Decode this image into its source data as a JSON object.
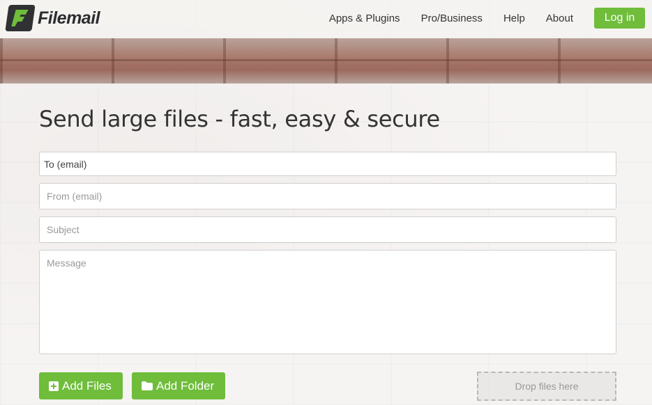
{
  "brand": {
    "name": "Filemail",
    "accent": "#6fbd3b"
  },
  "nav": {
    "items": [
      {
        "label": "Apps & Plugins"
      },
      {
        "label": "Pro/Business"
      },
      {
        "label": "Help"
      },
      {
        "label": "About"
      }
    ],
    "login_label": "Log in"
  },
  "main": {
    "headline": "Send large files - fast, easy & secure",
    "form": {
      "to_placeholder": "To (email)",
      "from_placeholder": "From (email)",
      "subject_placeholder": "Subject",
      "message_placeholder": "Message"
    },
    "actions": {
      "add_files_label": "Add Files",
      "add_files_icon": "plus-square-icon",
      "add_folder_label": "Add Folder",
      "add_folder_icon": "folder-icon",
      "drop_label": "Drop files here"
    }
  }
}
